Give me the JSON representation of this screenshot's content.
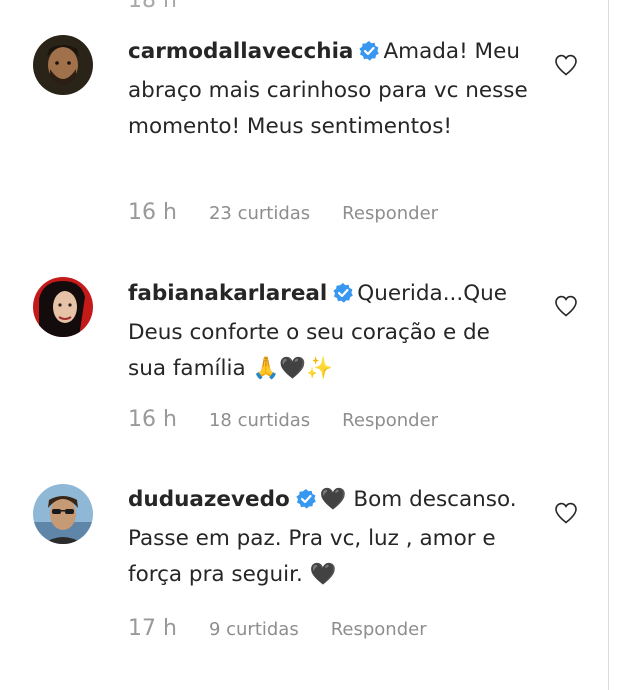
{
  "top_timestamp": "18 h",
  "comments": [
    {
      "username": "carmodallavecchia",
      "text": "Amada! Meu abraço mais carinhoso para vc nesse momento! Meus sentimentos!",
      "time": "16 h",
      "likes": "23 curtidas",
      "reply": "Responder",
      "avatar_icon": "man-beard-avatar"
    },
    {
      "username": "fabianakarlareal",
      "text": "Querida...Que Deus conforte o seu coração e de sua família 🙏🖤✨",
      "time": "16 h",
      "likes": "18 curtidas",
      "reply": "Responder",
      "avatar_icon": "woman-dark-hair-avatar"
    },
    {
      "username": "duduazevedo",
      "text_prefix": "🖤",
      "text": "Bom descanso. Passe em paz. Pra vc, luz , amor e força pra seguir. 🖤",
      "time": "17 h",
      "likes": "9 curtidas",
      "reply": "Responder",
      "avatar_icon": "man-sunglasses-avatar"
    }
  ],
  "colors": {
    "verified": "#3897f0",
    "meta": "#8e8e8e",
    "text": "#262626"
  }
}
